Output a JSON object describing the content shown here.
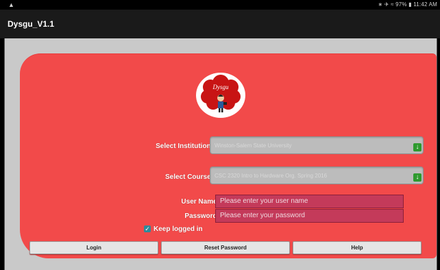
{
  "status_bar": {
    "warning_icon": "warning-icon",
    "right_text": "∗ ✈ ≈ 97% ▮ 11:42 AM"
  },
  "app": {
    "title": "Dysgu_V1.1"
  },
  "logo": {
    "text": "Dysgu",
    "icon": "dysgu-logo-icon"
  },
  "form": {
    "institution_label": "Select Institution:",
    "institution_value": "Winston-Salem State University",
    "course_label": "Select Course:",
    "course_value": "CSC 2320 Intro to Hardware Org. Spring 2016",
    "username_label": "User Name:",
    "username_placeholder": "Please enter your user name",
    "password_label": "Password:",
    "password_placeholder": "Please enter your password",
    "keep_logged_in_label": "Keep logged in",
    "keep_logged_in_checked": true
  },
  "buttons": {
    "login": "Login",
    "reset_password": "Reset Password",
    "help": "Help"
  },
  "colors": {
    "card": "#f24a4a",
    "field": "#c43a5a",
    "select": "#bcbcbc",
    "arrow": "#2e9a2e"
  }
}
